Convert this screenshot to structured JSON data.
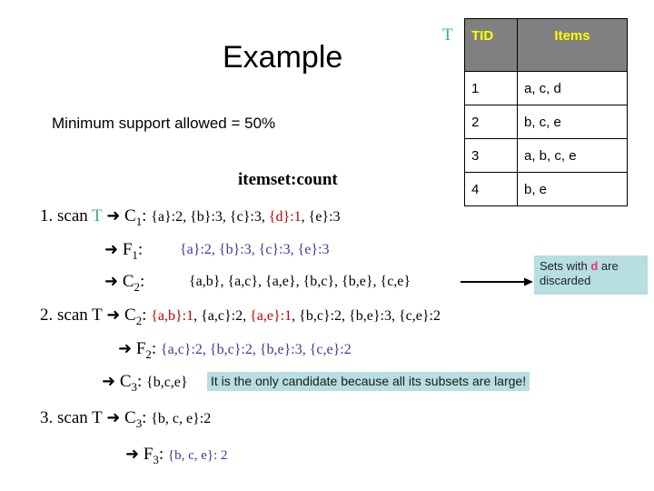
{
  "slide": {
    "title": "Example",
    "min_support": "Minimum support allowed = 50%",
    "itemset_count_header": "itemset:count"
  },
  "table": {
    "label": "T",
    "label_color": "#3CB371",
    "header_bg": "#808080",
    "header_color": "#FFFF00",
    "columns": [
      "TID",
      "Items"
    ],
    "rows": [
      {
        "tid": "1",
        "items": "a, c, d"
      },
      {
        "tid": "2",
        "items": "b, c, e"
      },
      {
        "tid": "3",
        "items": "a, b, c, e"
      },
      {
        "tid": "4",
        "items": "b, e"
      }
    ]
  },
  "steps": {
    "scan1": {
      "prefix": "1. scan ",
      "t": "T",
      "arrow": "➜",
      "label": "C",
      "sub": "1",
      "colon": ":",
      "items_pre": "{a}:2, {b}:3, {c}:3, ",
      "items_red": "{d}:1",
      "items_post": ", {e}:3"
    },
    "f1": {
      "arrow": "➜",
      "label": "F",
      "sub": "1",
      "colon": ":",
      "items": "{a}:2, {b}:3, {c}:3, {e}:3"
    },
    "c2_gen": {
      "arrow": "➜",
      "label": "C",
      "sub": "2",
      "colon": ":",
      "items": "{a,b}, {a,c}, {a,e}, {b,c}, {b,e}, {c,e}"
    },
    "scan2": {
      "prefix": "2. scan ",
      "t": "T",
      "arrow": "➜",
      "label": "C",
      "sub": "2",
      "colon": ":",
      "part1_red": "{a,b}:1",
      "part2": ", {a,c}:2, ",
      "part3_red": "{a,e}:1",
      "part4": ", {b,c}:2, {b,e}:3, {c,e}:2"
    },
    "f2": {
      "arrow": "➜",
      "label": "F",
      "sub": "2",
      "colon": ":",
      "items": "{a,c}:2, {b,c}:2, {b,e}:3, {c,e}:2"
    },
    "c3_gen": {
      "arrow": "➜",
      "label": "C",
      "sub": "3",
      "colon": ":",
      "items": "{b,c,e}",
      "note": "It is the only candidate because all its subsets are large!"
    },
    "scan3": {
      "prefix": "3. scan ",
      "t": "T",
      "arrow": "➜",
      "label": "C",
      "sub": "3",
      "colon": ":",
      "items": "{b, c, e}:2"
    },
    "f3": {
      "arrow": "➜",
      "label": "F",
      "sub": "3",
      "colon": ":",
      "items": "{b, c, e}: 2"
    }
  },
  "callout": {
    "text_pre": "Sets with ",
    "text_highlight": "d",
    "text_post": " are",
    "text_line2": "discarded",
    "bg": "#B7DEE0"
  }
}
